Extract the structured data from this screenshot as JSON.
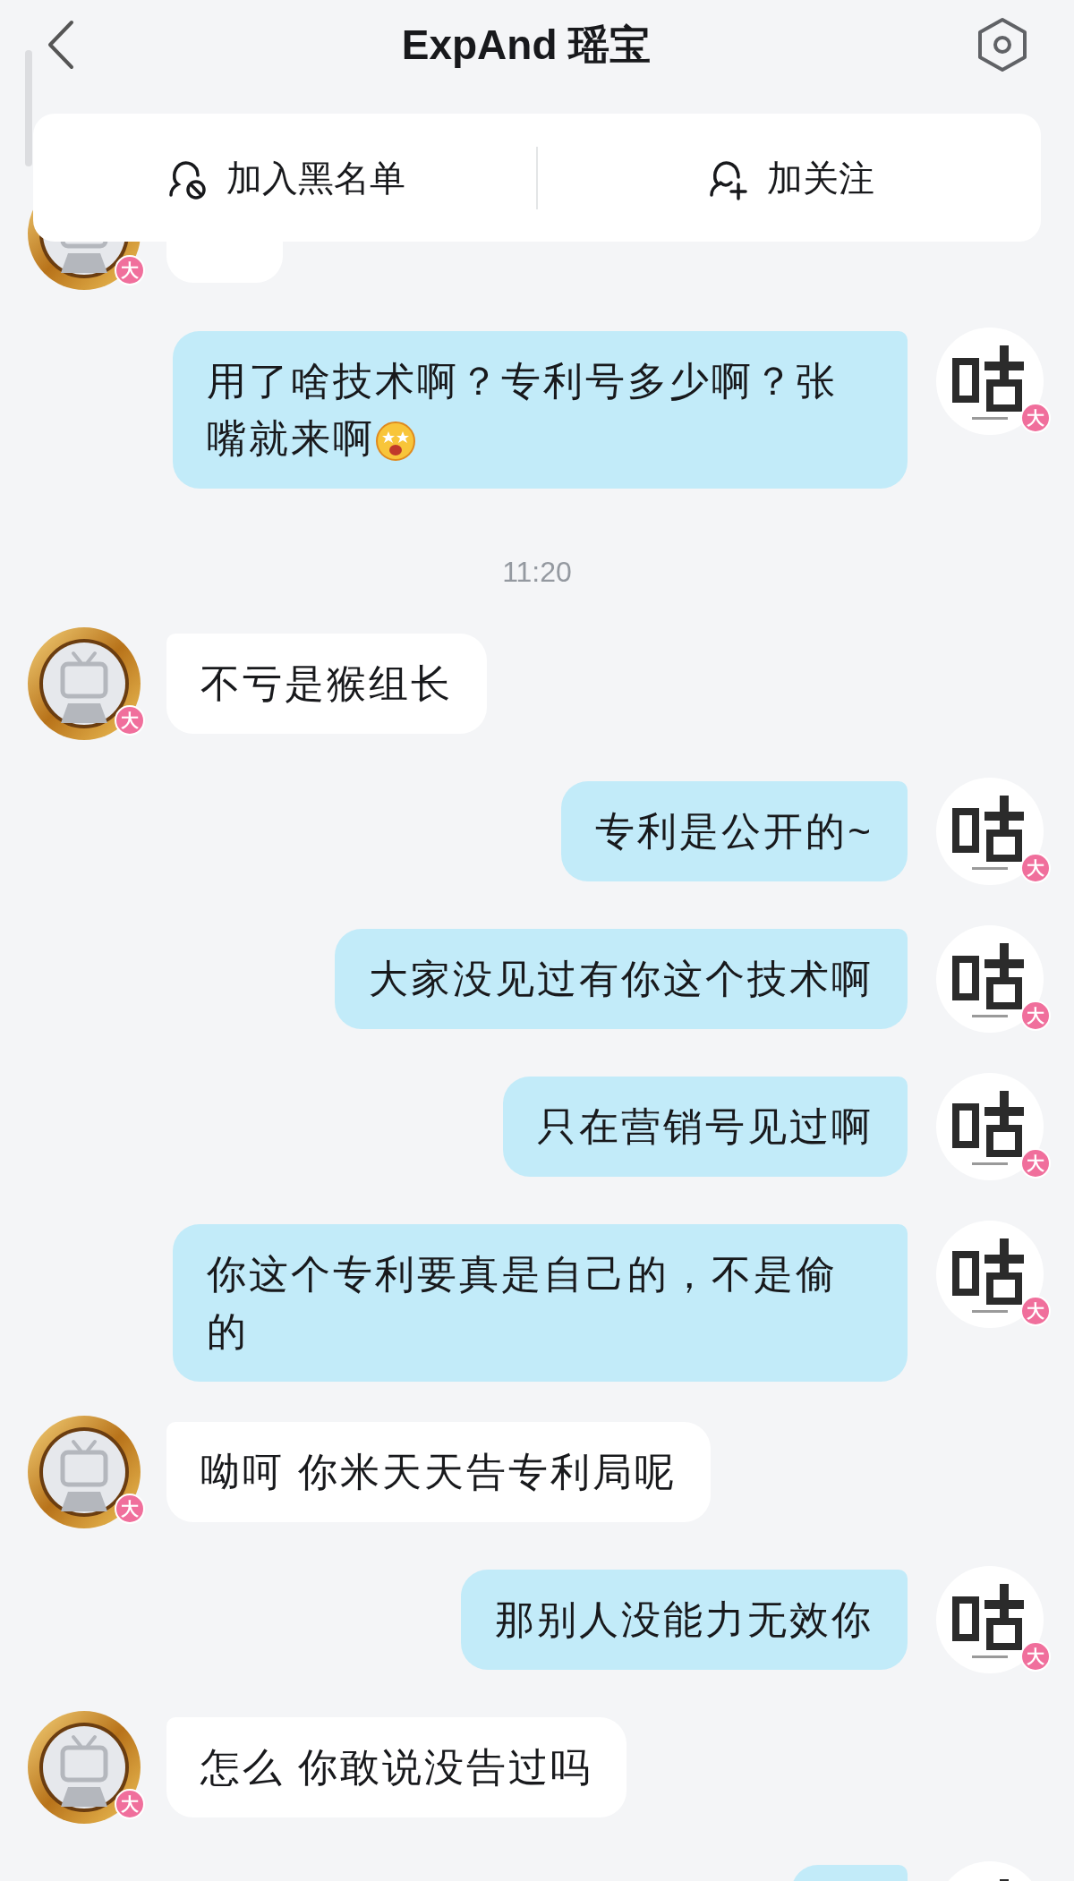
{
  "header": {
    "title": "ExpAnd 瑶宝"
  },
  "actions": [
    {
      "label": "加入黑名单",
      "kind": "block"
    },
    {
      "label": "加关注",
      "kind": "follow"
    }
  ],
  "messages": [
    {
      "kind": "received",
      "badge": "大"
    },
    {
      "kind": "sent",
      "text": "用了啥技术啊？专利号多少啊？张嘴就来啊",
      "has_emoji": true,
      "badge": "大"
    },
    {
      "kind": "time",
      "text": "11:20"
    },
    {
      "kind": "received",
      "text": "不亏是猴组长",
      "badge": "大"
    },
    {
      "kind": "sent",
      "text": "专利是公开的~",
      "badge": "大"
    },
    {
      "kind": "sent",
      "text": "大家没见过有你这个技术啊",
      "badge": "大"
    },
    {
      "kind": "sent",
      "text": "只在营销号见过啊",
      "badge": "大"
    },
    {
      "kind": "sent",
      "text": "你这个专利要真是自己的，不是偷的",
      "badge": "大"
    },
    {
      "kind": "received",
      "text": "呦呵 你米天天告专利局呢",
      "badge": "大"
    },
    {
      "kind": "sent",
      "text": "那别人没能力无效你",
      "badge": "大"
    },
    {
      "kind": "received",
      "text": "怎么 你敢说没告过吗",
      "badge": "大"
    },
    {
      "kind": "sent"
    }
  ]
}
